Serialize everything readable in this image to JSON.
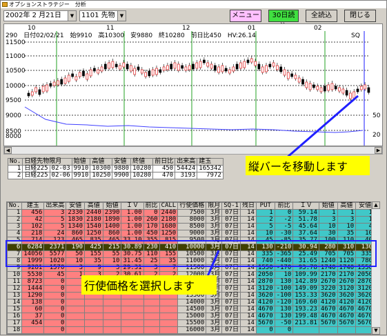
{
  "titlebar": {
    "title": "オプションストラテジー　分析"
  },
  "toolbar": {
    "date": "2002年 2 月21日",
    "contract": "1101 先物",
    "menu_label": "メニュー",
    "read30_label": "30日読込",
    "readall_label": "全読込",
    "close_label": "閉じる",
    "colors": {
      "menu": "#ffc0ff",
      "read30": "#40e040",
      "readall": "#d4d0c8",
      "close": "#d4d0c8"
    }
  },
  "chart": {
    "info": "290　日付02/02/21　始9910　高10300　安9880　終10280　前日比450　HV:26.14",
    "month_labels": [
      "10",
      "11",
      "12",
      "01",
      "02"
    ],
    "sq_label": "SQ",
    "y_labels": [
      "11500",
      "11000",
      "10500",
      "10000",
      "9500",
      "9000",
      "8500",
      "8000"
    ],
    "right_labels": [
      "50",
      "20"
    ]
  },
  "grid1": {
    "headers": [
      "No.",
      "日経先物限月",
      "始値",
      "高値",
      "安値",
      "終値",
      "前日比",
      "出来高",
      "建玉"
    ],
    "rows": [
      [
        "1",
        "日経225",
        "02-03",
        "9910",
        "10300",
        "9880",
        "10280",
        "450",
        "54424",
        "165342"
      ],
      [
        "2",
        "日経225",
        "02-06",
        "9910",
        "10250",
        "9900",
        "10280",
        "470",
        "3193",
        "7972"
      ]
    ]
  },
  "grid2": {
    "headers": [
      "No.",
      "建玉",
      "出来高",
      "安値",
      "高値",
      "始値",
      "ＩＶ",
      "前比",
      "CALL",
      "行使価格",
      "限月",
      "SQ-1",
      "残日",
      "PUT",
      "前比",
      "ＩＶ",
      "始値",
      "高値",
      "安値",
      "出来高",
      "建玉"
    ],
    "rows": [
      [
        "1",
        "456",
        "3",
        "2330",
        "2440",
        "2390",
        "1.00",
        "0",
        "2440",
        "7500",
        "3月",
        "07日",
        "14",
        "1",
        "0",
        "59.14",
        "1",
        "1",
        "1",
        "40",
        "7749"
      ],
      [
        "2",
        "42",
        "5",
        "1830",
        "2180",
        "1890",
        "1.00",
        "260",
        "2180",
        "8000",
        "3月",
        "07日",
        "14",
        "2",
        "-2",
        "51.78",
        "3",
        "3",
        "1",
        "3497",
        "8716"
      ],
      [
        "3",
        "102",
        "5",
        "1340",
        "1540",
        "1400",
        "1.00",
        "170",
        "1680",
        "8500",
        "3月",
        "07日",
        "14",
        "5",
        "-5",
        "45.64",
        "10",
        "10",
        "4",
        "3169",
        "9060"
      ],
      [
        "4",
        "218",
        "24",
        "860",
        "1250",
        "860",
        "1.00",
        "450",
        "1250",
        "9000",
        "3月",
        "07日",
        "14",
        "10",
        "-30",
        "37.64",
        "30",
        "35",
        "10",
        "2333",
        "27101"
      ],
      [
        "5",
        "714",
        "123",
        "465",
        "835",
        "465",
        "33.10",
        "355",
        "815",
        "9500",
        "3月",
        "07日",
        "14",
        "45",
        "-85",
        "35.77",
        "100",
        "110",
        "40",
        "5615",
        "8998"
      ],
      [
        "6",
        "6284",
        "2371",
        "190",
        "425",
        "215",
        "30.89",
        "230",
        "410",
        "10000",
        "3月",
        "07日",
        "14",
        "130",
        "-210",
        "30.94",
        "280",
        "310",
        "130",
        "2180",
        "6592"
      ],
      [
        "7",
        "14056",
        "5577",
        "50",
        "155",
        "55",
        "30.75",
        "110",
        "155",
        "10500",
        "3月",
        "07日",
        "14",
        "335",
        "-365",
        "25.49",
        "705",
        "705",
        "335",
        "190",
        "2153"
      ],
      [
        "8",
        "1999",
        "1020",
        "10",
        "35",
        "10",
        "31.45",
        "25",
        "35",
        "11000",
        "3月",
        "07日",
        "14",
        "740",
        "-440",
        "31.65",
        "1240",
        "1120",
        "780",
        "30",
        "1"
      ],
      [
        "9",
        "9281",
        "1570",
        "3",
        "9",
        "3",
        "29.31",
        "3",
        "7",
        "11500",
        "3月",
        "07日",
        "14",
        "1550",
        "-170",
        "93.78",
        "1740",
        "1740",
        "1550",
        "2",
        "32"
      ],
      [
        "10",
        "5530",
        "45",
        "1",
        "3",
        "2",
        "30.61",
        "2",
        "2",
        "12000",
        "3月",
        "07日",
        "14",
        "2050",
        "10",
        "109.99",
        "2170",
        "2170",
        "2050",
        "2",
        "29"
      ],
      [
        "11",
        "8723",
        "0",
        "",
        "",
        "",
        "",
        "",
        "",
        "12500",
        "3月",
        "07日",
        "14",
        "2870",
        "130",
        "142.89",
        "2670",
        "2670",
        "2870",
        "2",
        "2"
      ],
      [
        "12",
        "1444",
        "0",
        "",
        "",
        "",
        "",
        "",
        "",
        "13000",
        "3月",
        "07日",
        "14",
        "3120",
        "-100",
        "149.09",
        "3220",
        "3120",
        "3120",
        "1",
        "6"
      ],
      [
        "13",
        "1290",
        "0",
        "",
        "",
        "",
        "",
        "",
        "",
        "13500",
        "3月",
        "07日",
        "14",
        "3620",
        "-100",
        "153.33",
        "3620",
        "3620",
        "3620",
        "1",
        "1"
      ],
      [
        "14",
        "138",
        "0",
        "",
        "",
        "",
        "",
        "",
        "",
        "14000",
        "3月",
        "07日",
        "14",
        "4120",
        "-120",
        "169.60",
        "4120",
        "4120",
        "4120",
        "2",
        "2"
      ],
      [
        "15",
        "60",
        "0",
        "",
        "",
        "",
        "",
        "",
        "",
        "14500",
        "3月",
        "07日",
        "14",
        "4670",
        "130",
        "193.23",
        "4670",
        "4670",
        "4670",
        "1",
        "1"
      ],
      [
        "16",
        "37",
        "0",
        "",
        "",
        "",
        "",
        "",
        "",
        "15000",
        "3月",
        "07日",
        "14",
        "4670",
        "130",
        "199.48",
        "4670",
        "4670",
        "4670",
        "1",
        "1"
      ],
      [
        "17",
        "454",
        "0",
        "",
        "",
        "",
        "",
        "",
        "",
        "15500",
        "3月",
        "07日",
        "14",
        "5670",
        "-50",
        "213.81",
        "5670",
        "5670",
        "5670",
        "1",
        "1"
      ],
      [
        "18",
        "",
        "0",
        "",
        "",
        "",
        "",
        "",
        "",
        "16000",
        "3月",
        "07日",
        "14",
        "0",
        "0",
        "",
        "",
        "",
        "",
        "",
        "21"
      ]
    ],
    "selected_row": 5
  },
  "callouts": {
    "vertical_bar": "縦バーを移動します",
    "select_strike": "行使価格を選択します"
  }
}
